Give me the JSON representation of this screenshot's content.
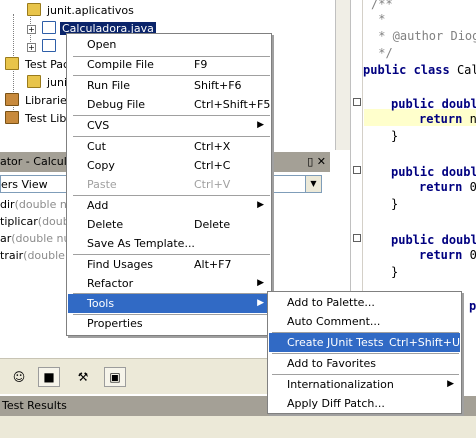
{
  "tree": {
    "items": [
      {
        "label": "junit.aplicativos"
      },
      {
        "label": "Calculadora.java"
      },
      {
        "label": "Test Pac"
      },
      {
        "label": "junit."
      },
      {
        "label": "Libraries"
      },
      {
        "label": "Test Libr"
      }
    ]
  },
  "navigator": {
    "title": "ator - Calcula",
    "title_buttons": "▯ ✕",
    "combo_value": "ers View",
    "members": [
      {
        "name": "dir",
        "params": "(double num"
      },
      {
        "name": "tiplicar",
        "params": "(double"
      },
      {
        "name": "ar",
        "params": "(double num"
      },
      {
        "name": "trair",
        "params": "(double num"
      }
    ]
  },
  "editor": {
    "comment_lines": [
      "/**",
      " *",
      " * @author Diogo",
      " */"
    ],
    "class_kw": "public class",
    "class_name": "Calc",
    "methods": [
      {
        "line1_kw": "public",
        "line1_rest": "doubl",
        "line2_kw": "return",
        "line2_rest": "n"
      },
      {
        "line1_kw": "public",
        "line1_rest": "doubl",
        "line2_kw": "return",
        "line2_rest": "0"
      },
      {
        "line1_kw": "public",
        "line1_rest": "doubl",
        "line2_kw": "return",
        "line2_rest": "0"
      }
    ],
    "closing_brace": "}",
    "partial_kw": "publ"
  },
  "context_menu": {
    "items": [
      {
        "label": "Open",
        "shortcut": ""
      },
      {
        "label": "Compile File",
        "shortcut": "F9"
      },
      {
        "label": "Run File",
        "shortcut": "Shift+F6"
      },
      {
        "label": "Debug File",
        "shortcut": "Ctrl+Shift+F5"
      },
      {
        "label": "CVS",
        "shortcut": ""
      },
      {
        "label": "Cut",
        "shortcut": "Ctrl+X"
      },
      {
        "label": "Copy",
        "shortcut": "Ctrl+C"
      },
      {
        "label": "Paste",
        "shortcut": "Ctrl+V"
      },
      {
        "label": "Add",
        "shortcut": ""
      },
      {
        "label": "Delete",
        "shortcut": "Delete"
      },
      {
        "label": "Save As Template...",
        "shortcut": ""
      },
      {
        "label": "Find Usages",
        "shortcut": "Alt+F7"
      },
      {
        "label": "Refactor",
        "shortcut": ""
      },
      {
        "label": "Tools",
        "shortcut": ""
      },
      {
        "label": "Properties",
        "shortcut": ""
      }
    ]
  },
  "tools_submenu": {
    "items": [
      {
        "label": "Add to Palette...",
        "shortcut": ""
      },
      {
        "label": "Auto Comment...",
        "shortcut": ""
      },
      {
        "label": "Create JUnit Tests",
        "shortcut": "Ctrl+Shift+U"
      },
      {
        "label": "Add to Favorites",
        "shortcut": ""
      },
      {
        "label": "Internationalization",
        "shortcut": ""
      },
      {
        "label": "Apply Diff Patch...",
        "shortcut": ""
      }
    ]
  },
  "bottom": {
    "tests_tab_label": "Test Results"
  },
  "glyphs": {
    "arrow": "▶",
    "expander": "+",
    "combo_arrow": "▼"
  }
}
